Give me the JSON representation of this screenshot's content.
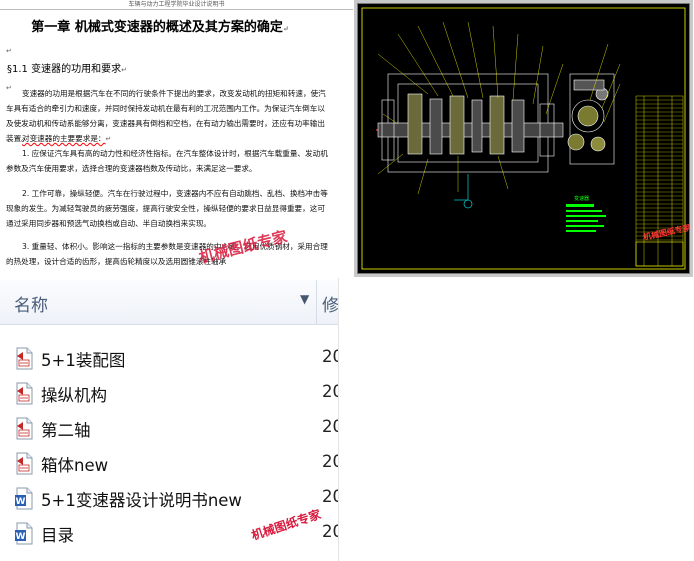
{
  "document": {
    "header": "车辆与动力工程学院毕业设计说明书",
    "title": "第一章 机械式变速器的概述及其方案的确定",
    "section": "§1.1 变速器的功用和要求",
    "paragraphs": [
      "变速器的功用是根据汽车在不同的行驶条件下提出的要求，改变发动机的扭矩和转速，使汽车具有适合的牵引力和速度，并同时保持发动机在最有利的工况范围内工作。为保证汽车倒车以及使发动机和传动系能够分离，变速器具有倒档和空档，在有动力输出需要时，还应有功率输出装置。",
      "对变速器的主要要求是：",
      "1. 应保证汽车具有高的动力性和经济性指标。在汽车整体设计时，根据汽车载重量、发动机参数及汽车使用要求，选择合理的变速器档数及传动比，来满足这一要求。",
      "2. 工作可靠，操纵轻便。汽车在行驶过程中，变速器内不应有自动跳档、乱档、换档冲击等现象的发生。为减轻驾驶员的疲劳强度，提高行驶安全性，操纵轻便的要求日益显得重要，这可通过采用同步器和预选气动换档或自动、半自动换档来实现。",
      "3. 重量轻、体积小。影响这一指标的主要参数是变速器的中心距。选用优质钢材，采用合理的热处理，设计合适的齿形，提高齿轮精度以及选用圆锥滚柱轴承"
    ],
    "watermark": "机械图纸专家"
  },
  "cad": {
    "watermark": "机械图纸专家",
    "title_block_label": "变速器"
  },
  "explorer": {
    "column_name": "名称",
    "column_modified": "修",
    "files": [
      {
        "name": "5+1装配图",
        "date": "20",
        "icon": "cad-file-icon"
      },
      {
        "name": "操纵机构",
        "date": "20",
        "icon": "cad-file-icon"
      },
      {
        "name": "第二轴",
        "date": "20",
        "icon": "cad-file-icon"
      },
      {
        "name": "箱体new",
        "date": "20",
        "icon": "cad-file-icon"
      },
      {
        "name": "5+1变速器设计说明书new",
        "date": "20",
        "icon": "word-file-icon"
      },
      {
        "name": "目录",
        "date": "20",
        "icon": "word-file-icon"
      }
    ],
    "watermark": "机械图纸专家"
  },
  "colors": {
    "cad_background": "#000000",
    "cad_yellow": "#ffff00",
    "cad_green": "#00ff00",
    "watermark_red": "#d8183c",
    "explorer_header_text": "#4a5d7a"
  }
}
